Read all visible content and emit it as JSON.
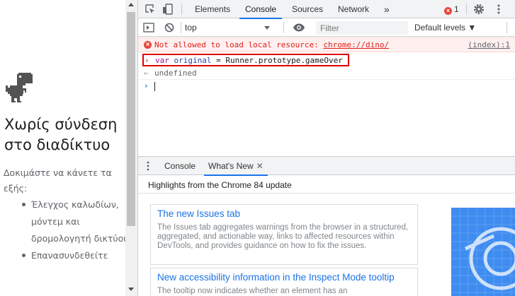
{
  "page": {
    "title": "Χωρίς σύνδεση στο διαδίκτυο",
    "subtitle": "Δοκιμάστε να κάνετε τα εξής:",
    "suggestions": [
      "Έλεγχος καλωδίων, μόντεμ και δρομολογητή δικτύου",
      "Επανασυνδεθείτε"
    ]
  },
  "devtools": {
    "tabs": [
      "Elements",
      "Console",
      "Sources",
      "Network"
    ],
    "more_tabs": "»",
    "error_count": "1",
    "console_toolbar": {
      "context": "top",
      "filter_placeholder": "Filter",
      "levels": "Default levels ▼"
    },
    "log": {
      "error_text_prefix": "Not allowed to load local resource: ",
      "error_link": "chrome://dino/",
      "error_source": "(index):1",
      "input_keyword": "var",
      "input_varname": "original",
      "input_rest": " = Runner.prototype.gameOver",
      "result": "undefined"
    },
    "drawer": {
      "tabs": [
        "Console",
        "What's New"
      ],
      "close": "✕",
      "header": "Highlights from the Chrome 84 update",
      "cards": [
        {
          "title": "The new Issues tab",
          "description": "The Issues tab aggregates warnings from the browser in a structured, aggregated, and actionable way, links to affected resources within DevTools, and provides guidance on how to fix the issues."
        },
        {
          "title": "New accessibility information in the Inspect Mode tooltip",
          "description": "The tooltip now indicates whether an element has an"
        }
      ]
    }
  },
  "colors": {
    "accent": "#1a73e8",
    "error": "#e8443a",
    "error_bg": "#fff0f0",
    "highlight_box": "#e00000"
  }
}
